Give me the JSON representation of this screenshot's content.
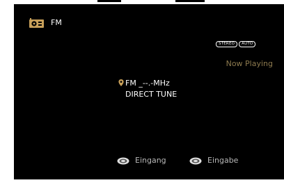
{
  "header": {
    "source_icon": "radio-icon",
    "source_label": "FM"
  },
  "status": {
    "badges": [
      "STEREO",
      "AUTO"
    ],
    "now_playing": "Now Playing"
  },
  "tuner": {
    "band": "FM",
    "frequency": "_--.-",
    "unit": "MHz",
    "mode": "DIRECT TUNE"
  },
  "hints": [
    {
      "icon": "dial-knob-icon",
      "label": "Eingang"
    },
    {
      "icon": "dial-knob-icon",
      "label": "Eingabe"
    }
  ],
  "colors": {
    "background": "#000000",
    "text": "#ffffff",
    "accent": "#8d7a4e",
    "hint_text": "#b8b8b8"
  }
}
